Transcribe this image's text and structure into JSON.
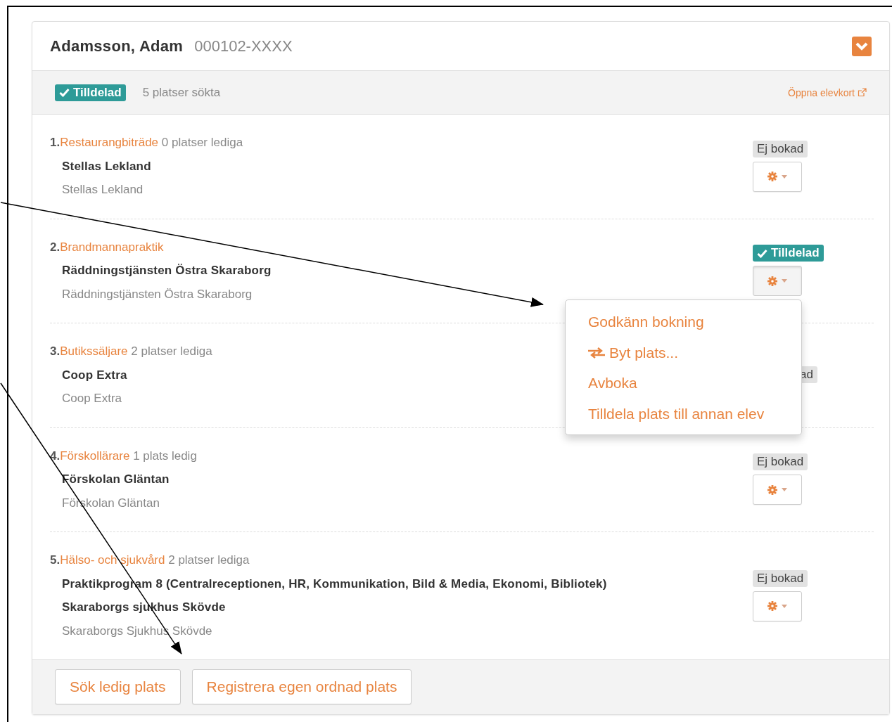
{
  "student": {
    "name": "Adamsson, Adam",
    "id": "000102-XXXX"
  },
  "status_bar": {
    "status": {
      "kind": "assigned",
      "label": "Tilldelad"
    },
    "searched": "5 platser sökta",
    "link": "Öppna elevkort"
  },
  "places": [
    {
      "number": "1.",
      "title": "Restaurangbiträde",
      "availability": "0 platser lediga",
      "lines": [
        "Stellas Lekland"
      ],
      "address": "Stellas Lekland",
      "status": {
        "kind": "not_booked",
        "label": "Ej bokad",
        "covered": false
      },
      "menu_open": false
    },
    {
      "number": "2.",
      "title": "Brandmannapraktik",
      "lines": [
        "Räddningstjänsten Östra Skaraborg"
      ],
      "address": "Räddningstjänsten Östra Skaraborg",
      "status": {
        "kind": "assigned",
        "label": "Tilldelad",
        "covered": false
      },
      "menu_open": true
    },
    {
      "number": "3.",
      "title": "Butikssäljare",
      "availability": "2 platser lediga",
      "lines": [
        "Coop Extra"
      ],
      "address": "Coop Extra",
      "status": {
        "kind": "not_booked",
        "label": "ad",
        "covered": true
      },
      "menu_open": false
    },
    {
      "number": "4.",
      "title": "Förskollärare",
      "availability": "1 plats ledig",
      "lines": [
        "Förskolan Gläntan"
      ],
      "address": "Förskolan Gläntan",
      "status": {
        "kind": "not_booked",
        "label": "Ej bokad",
        "covered": false
      },
      "menu_open": false
    },
    {
      "number": "5.",
      "title": "Hälso- och sjukvård",
      "availability": "2 platser lediga",
      "lines": [
        "Praktikprogram 8 (Centralreceptionen, HR, Kommunikation, Bild & Media, Ekonomi, Bibliotek)",
        "Skaraborgs sjukhus Skövde"
      ],
      "address": "Skaraborgs Sjukhus Skövde",
      "status": {
        "kind": "not_booked",
        "label": "Ej bokad",
        "covered": false
      },
      "menu_open": false
    }
  ],
  "menu": {
    "items": [
      {
        "kind": "plain",
        "label": "Godkänn bokning"
      },
      {
        "kind": "swap",
        "label": "Byt plats..."
      },
      {
        "kind": "plain",
        "label": "Avboka"
      },
      {
        "kind": "plain",
        "label": "Tilldela plats till annan elev"
      }
    ]
  },
  "buttons": [
    "Sök ledig plats",
    "Registrera egen ordnad plats"
  ]
}
